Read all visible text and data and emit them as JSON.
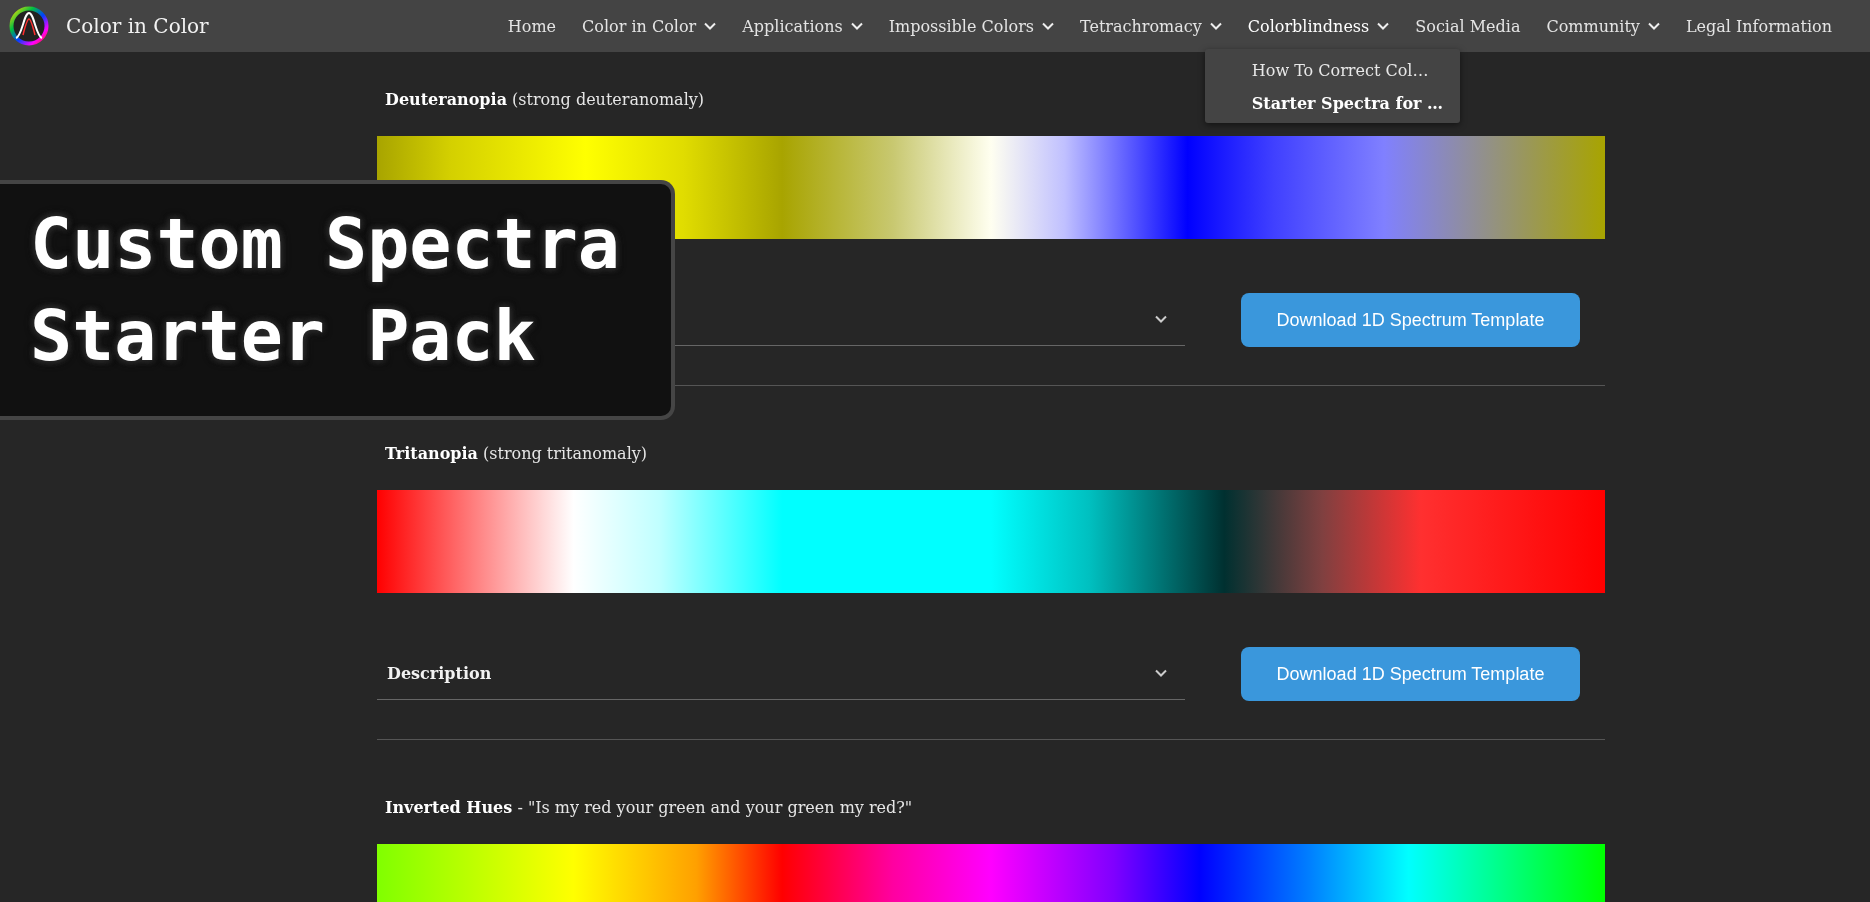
{
  "site": {
    "title": "Color in Color"
  },
  "nav": [
    {
      "label": "Home",
      "has_menu": false,
      "expanded": false
    },
    {
      "label": "Color in Color",
      "has_menu": true,
      "expanded": false
    },
    {
      "label": "Applications",
      "has_menu": true,
      "expanded": false
    },
    {
      "label": "Impossible Colors",
      "has_menu": true,
      "expanded": false
    },
    {
      "label": "Tetrachromacy",
      "has_menu": true,
      "expanded": false
    },
    {
      "label": "Colorblindness",
      "has_menu": true,
      "expanded": true,
      "submenu": [
        {
          "label": "How To Correct Col…",
          "selected": false
        },
        {
          "label": "Starter Spectra for …",
          "selected": true
        }
      ]
    },
    {
      "label": "Social Media",
      "has_menu": false,
      "expanded": false
    },
    {
      "label": "Community",
      "has_menu": true,
      "expanded": false
    },
    {
      "label": "Legal Information",
      "has_menu": false,
      "expanded": false
    }
  ],
  "sections": [
    {
      "caption": "**Deuteranopia** (strong deuteranomaly)",
      "kind": "deuteranopia",
      "has_description": true,
      "button": "Download 1D Spectrum Template"
    },
    {
      "caption": "**Tritanopia** (strong tritanomaly)",
      "kind": "tritanopia",
      "has_description": true,
      "description": "Description",
      "button": "Download 1D Spectrum Template"
    },
    {
      "caption": "**Inverted Hues** - \"Is my red your green and your green my red?\"",
      "kind": "inverted",
      "has_description": false
    }
  ],
  "overlay": {
    "lines": [
      "Custom Spectra",
      "Starter Pack"
    ]
  }
}
